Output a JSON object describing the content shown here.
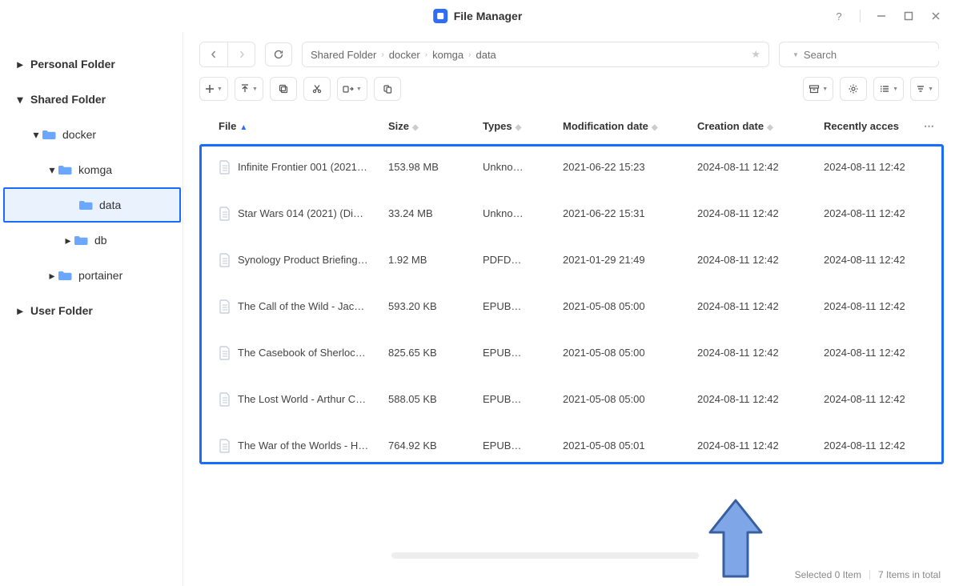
{
  "app": {
    "title": "File Manager"
  },
  "window_controls": {
    "help": "?"
  },
  "sidebar": {
    "sections": [
      {
        "label": "Personal Folder",
        "expanded": false,
        "level": 0
      },
      {
        "label": "Shared Folder",
        "expanded": true,
        "level": 0
      },
      {
        "label": "docker",
        "expanded": true,
        "level": 1
      },
      {
        "label": "komga",
        "expanded": true,
        "level": 2
      },
      {
        "label": "data",
        "expanded": false,
        "level": 3,
        "selected": true,
        "noarrow": true
      },
      {
        "label": "db",
        "expanded": false,
        "level": 3
      },
      {
        "label": "portainer",
        "expanded": false,
        "level": 2
      },
      {
        "label": "User Folder",
        "expanded": false,
        "level": 0
      }
    ]
  },
  "breadcrumbs": [
    "Shared Folder",
    "docker",
    "komga",
    "data"
  ],
  "search": {
    "placeholder": "Search"
  },
  "columns": {
    "file": "File",
    "size": "Size",
    "types": "Types",
    "mod": "Modification date",
    "creat": "Creation date",
    "acc": "Recently acces"
  },
  "files": [
    {
      "name": "Infinite Frontier 001 (2021…",
      "size": "153.98 MB",
      "types": "Unkno…",
      "mod": "2021-06-22 15:23",
      "creat": "2024-08-11 12:42",
      "acc": "2024-08-11 12:42"
    },
    {
      "name": "Star Wars 014 (2021) (Di…",
      "size": "33.24 MB",
      "types": "Unkno…",
      "mod": "2021-06-22 15:31",
      "creat": "2024-08-11 12:42",
      "acc": "2024-08-11 12:42"
    },
    {
      "name": "Synology Product Briefing…",
      "size": "1.92 MB",
      "types": "PDFD…",
      "mod": "2021-01-29 21:49",
      "creat": "2024-08-11 12:42",
      "acc": "2024-08-11 12:42"
    },
    {
      "name": "The Call of the Wild - Jac…",
      "size": "593.20 KB",
      "types": "EPUB…",
      "mod": "2021-05-08 05:00",
      "creat": "2024-08-11 12:42",
      "acc": "2024-08-11 12:42"
    },
    {
      "name": "The Casebook of Sherloc…",
      "size": "825.65 KB",
      "types": "EPUB…",
      "mod": "2021-05-08 05:00",
      "creat": "2024-08-11 12:42",
      "acc": "2024-08-11 12:42"
    },
    {
      "name": "The Lost World - Arthur C…",
      "size": "588.05 KB",
      "types": "EPUB…",
      "mod": "2021-05-08 05:00",
      "creat": "2024-08-11 12:42",
      "acc": "2024-08-11 12:42"
    },
    {
      "name": "The War of the Worlds - H…",
      "size": "764.92 KB",
      "types": "EPUB…",
      "mod": "2021-05-08 05:01",
      "creat": "2024-08-11 12:42",
      "acc": "2024-08-11 12:42"
    }
  ],
  "status": {
    "selected": "Selected 0 Item",
    "total": "7 Items in total"
  }
}
